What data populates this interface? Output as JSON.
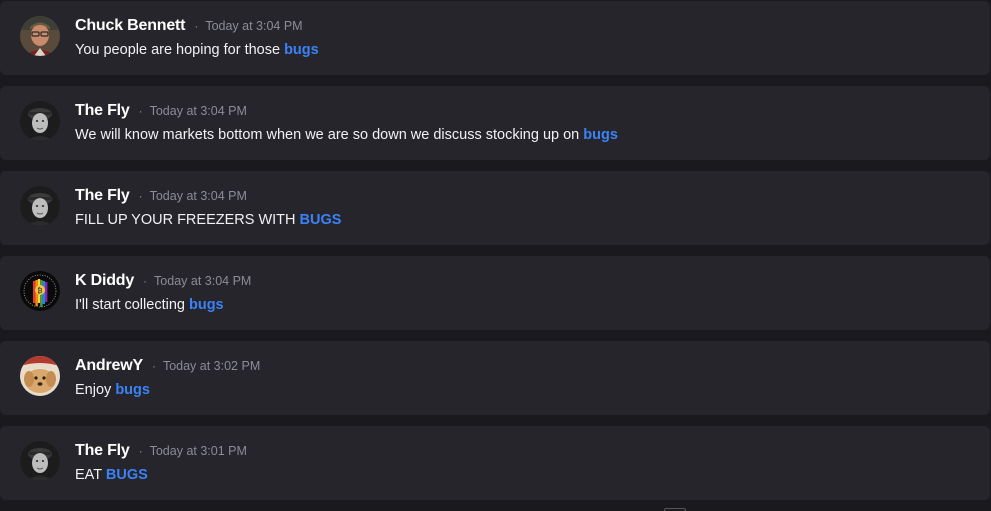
{
  "messages": [
    {
      "username": "Chuck Bennett",
      "separator": "·",
      "timestamp": "Today at 3:04 PM",
      "text": "You people are hoping for those ",
      "tag": "bugs",
      "avatar_icon": "user-avatar-chuck",
      "accent": "#3b82f6"
    },
    {
      "username": "The Fly",
      "separator": "·",
      "timestamp": "Today at 3:04 PM",
      "text": "We will know markets bottom when we are so down we discuss stocking up on ",
      "tag": "bugs",
      "avatar_icon": "user-avatar-thefly"
    },
    {
      "username": "The Fly",
      "separator": "·",
      "timestamp": "Today at 3:04 PM",
      "text": "FILL UP YOUR FREEZERS WITH ",
      "tag": "BUGS",
      "avatar_icon": "user-avatar-thefly"
    },
    {
      "username": "K Diddy",
      "separator": "·",
      "timestamp": "Today at 3:04 PM",
      "text": "I'll start collecting ",
      "tag": "bugs",
      "avatar_icon": "user-avatar-kdiddy"
    },
    {
      "username": "AndrewY",
      "separator": "·",
      "timestamp": "Today at 3:02 PM",
      "text": "Enjoy ",
      "tag": "bugs",
      "avatar_icon": "user-avatar-andrewy"
    },
    {
      "username": "The Fly",
      "separator": "·",
      "timestamp": "Today at 3:01 PM",
      "text": "EAT ",
      "tag": "BUGS",
      "avatar_icon": "user-avatar-thefly"
    }
  ],
  "colors": {
    "background": "#1a1a1e",
    "card": "#25252b",
    "username": "#ffffff",
    "timestamp": "#8c8c95",
    "tag": "#3b82f6"
  }
}
